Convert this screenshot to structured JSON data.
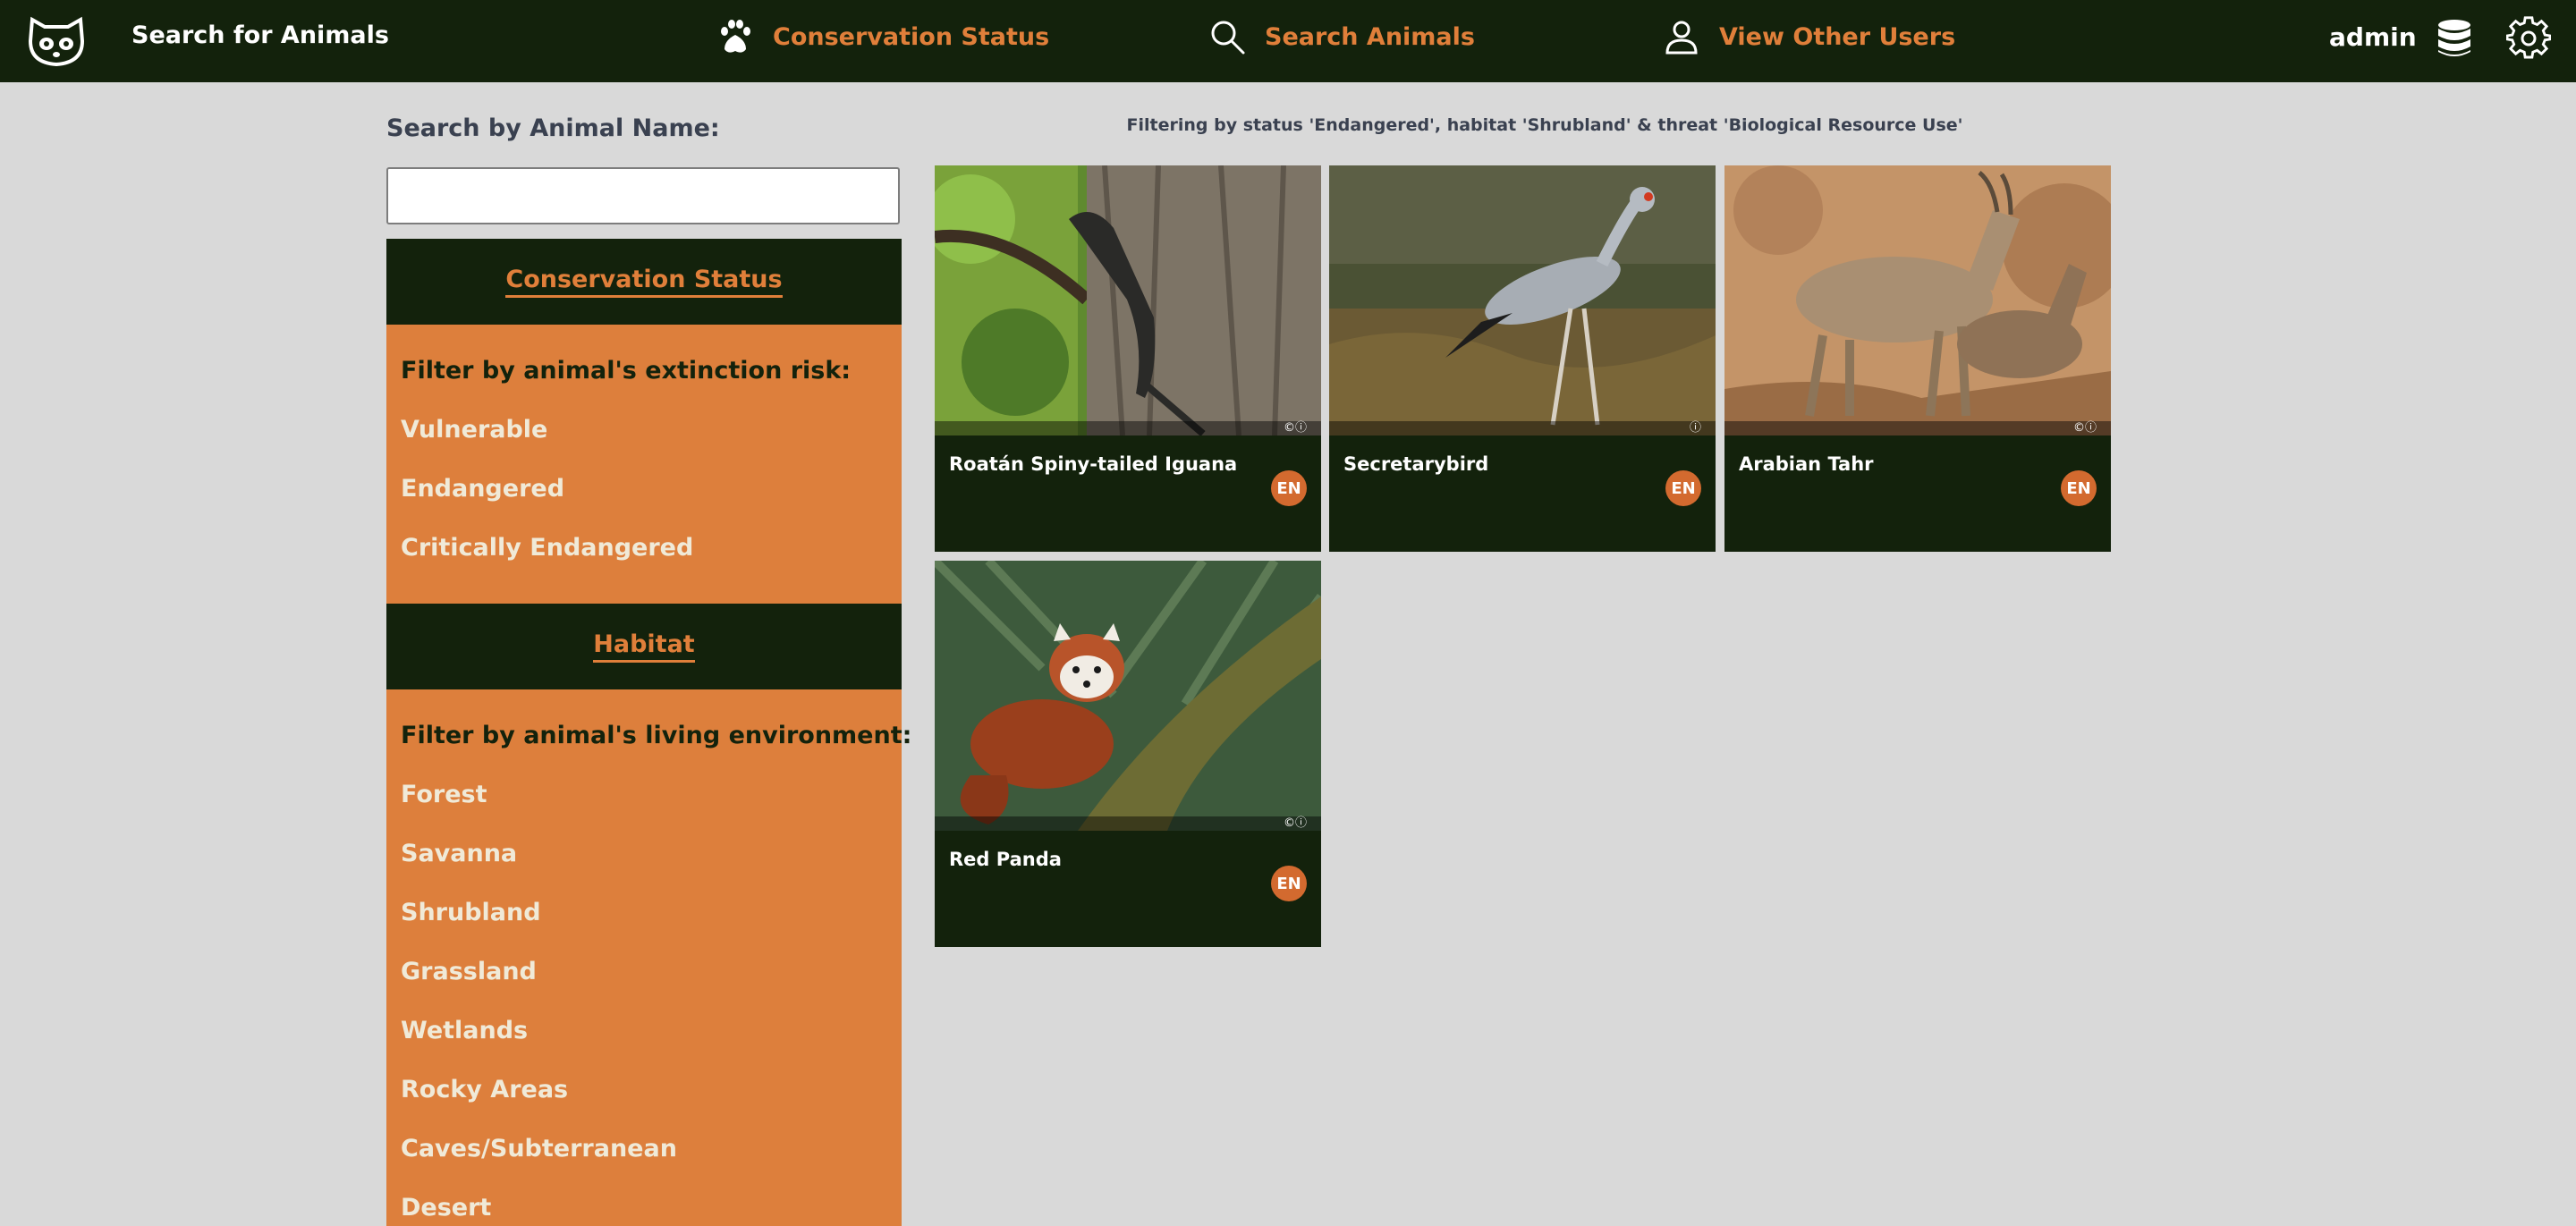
{
  "header": {
    "app_title": "Search for Animals",
    "nav": [
      {
        "label": "Conservation Status",
        "icon": "paw-icon"
      },
      {
        "label": "Search Animals",
        "icon": "search-icon"
      },
      {
        "label": "View Other Users",
        "icon": "user-icon"
      }
    ],
    "username": "admin",
    "icons": [
      "red-panda-logo-icon",
      "database-icon",
      "gear-icon"
    ]
  },
  "sidebar": {
    "search_label": "Search by Animal Name:",
    "search_value": "",
    "status_section": {
      "title": "Conservation Status",
      "heading": "Filter by animal's extinction risk:",
      "options": [
        "Vulnerable",
        "Endangered",
        "Critically Endangered"
      ]
    },
    "habitat_section": {
      "title": "Habitat",
      "heading": "Filter by animal's living environment:",
      "options": [
        "Forest",
        "Savanna",
        "Shrubland",
        "Grassland",
        "Wetlands",
        "Rocky Areas",
        "Caves/Subterranean",
        "Desert"
      ]
    }
  },
  "main": {
    "filter_text": "Filtering by status 'Endangered', habitat 'Shrubland' & threat 'Biological Resource Use'",
    "cards": [
      {
        "name": "Roatán Spiny-tailed Iguana",
        "status": "EN"
      },
      {
        "name": "Secretarybird",
        "status": "EN"
      },
      {
        "name": "Arabian Tahr",
        "status": "EN"
      },
      {
        "name": "Red Panda",
        "status": "EN"
      }
    ]
  },
  "colors": {
    "nav_bg": "#13220c",
    "accent": "#e07f3a",
    "panel_orange": "#dd7f3c",
    "page_bg": "#d9d9d9",
    "badge": "#d36a2f"
  }
}
